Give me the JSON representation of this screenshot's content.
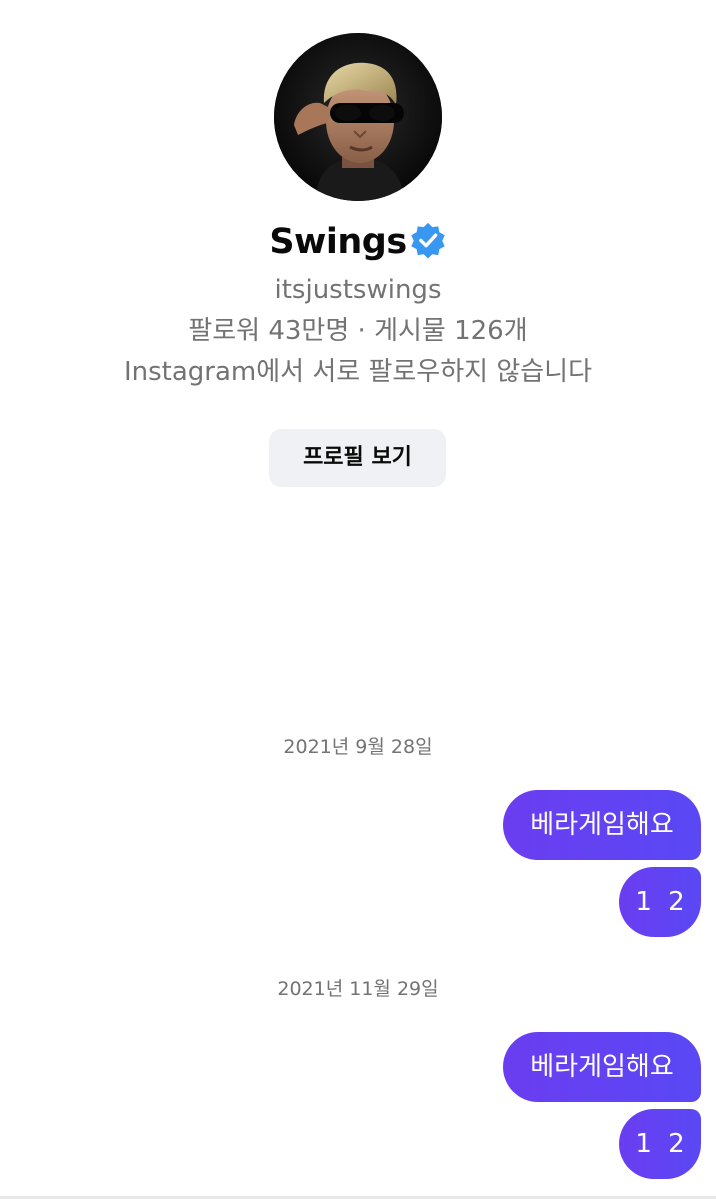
{
  "profile": {
    "display_name": "Swings",
    "username": "itsjustswings",
    "stats": "팔로워 43만명 · 게시물 126개",
    "follow_status": "Instagram에서 서로 팔로우하지 않습니다",
    "view_profile_label": "프로필 보기",
    "verified": true,
    "verified_color": "#3897f0"
  },
  "thread": [
    {
      "date": "2021년 9월 28일",
      "messages": [
        "베라게임해요",
        "1 2"
      ]
    },
    {
      "date": "2021년 11월 29일",
      "messages": [
        "베라게임해요",
        "1 2"
      ]
    }
  ],
  "colors": {
    "bubble": "#6a3df0",
    "bubble_text": "#ffffff",
    "secondary_text": "#737373",
    "button_bg": "#eff1f4"
  }
}
